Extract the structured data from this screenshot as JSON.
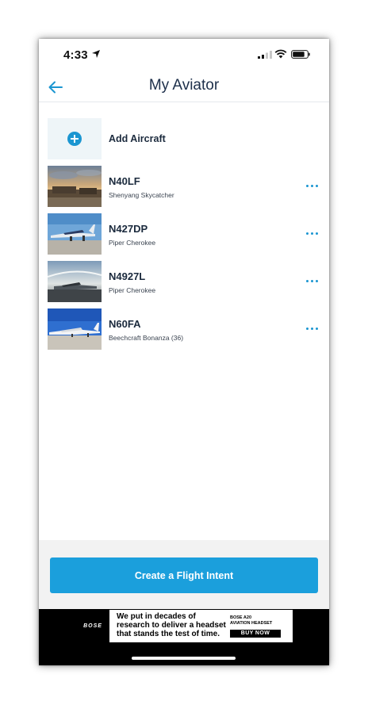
{
  "status_bar": {
    "time": "4:33"
  },
  "header": {
    "title": "My Aviator"
  },
  "add_aircraft": {
    "label": "Add Aircraft"
  },
  "aircraft": [
    {
      "tail": "N40LF",
      "model": "Shenyang Skycatcher"
    },
    {
      "tail": "N427DP",
      "model": "Piper Cherokee"
    },
    {
      "tail": "N4927L",
      "model": "Piper Cherokee"
    },
    {
      "tail": "N60FA",
      "model": "Beechcraft Bonanza (36)"
    }
  ],
  "cta": {
    "label": "Create a Flight Intent"
  },
  "ad": {
    "brand": "BOSE",
    "lines": [
      "We put in decades of",
      "research to deliver a headset",
      "that stands the test of time."
    ],
    "product": [
      "BOSE A20",
      "AVIATION HEADSET"
    ],
    "buy_label": "BUY NOW"
  },
  "colors": {
    "accent": "#1b9fdc",
    "title": "#1d2f4a",
    "bottom_bg": "#f2f2f2"
  }
}
